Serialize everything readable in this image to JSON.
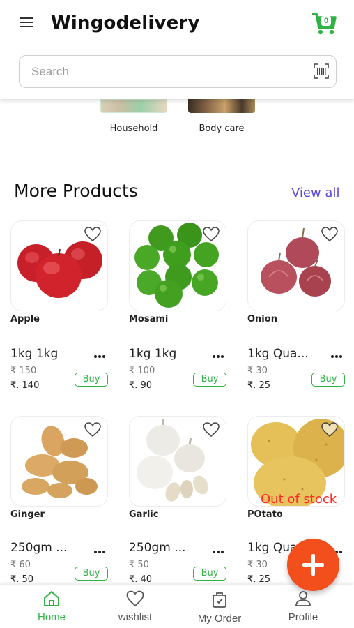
{
  "header": {
    "title": "Wingodelivery",
    "cart_count": "0",
    "search_placeholder": "Search"
  },
  "categories": [
    {
      "label": "Household"
    },
    {
      "label": "Body care"
    }
  ],
  "section": {
    "title": "More Products",
    "view_all": "View all"
  },
  "products": [
    {
      "name": "Apple",
      "qty": "1kg 1kg",
      "mrp": "₹ 150",
      "price": "₹. 140",
      "buy": "Buy"
    },
    {
      "name": "Mosami",
      "qty": "1kg 1kg",
      "mrp": "₹ 100",
      "price": "₹. 90",
      "buy": "Buy"
    },
    {
      "name": "Onion",
      "qty": "1kg Qua...",
      "mrp": "₹ 30",
      "price": "₹. 25",
      "buy": "Buy"
    },
    {
      "name": "Ginger",
      "qty": "250gm ...",
      "mrp": "₹ 60",
      "price": "₹. 50",
      "buy": "Buy"
    },
    {
      "name": "Garlic",
      "qty": "250gm ...",
      "mrp": "₹ 50",
      "price": "₹. 40",
      "buy": "Buy"
    },
    {
      "name": "POtato",
      "qty": "1kg Qua...",
      "mrp": "₹ 30",
      "price": "₹. 25",
      "stock_label": "Out of stock"
    }
  ],
  "bottom_nav": [
    {
      "label": "Home",
      "icon": "home-icon",
      "active": true
    },
    {
      "label": "wishlist",
      "icon": "heart-icon",
      "active": false
    },
    {
      "label": "My Order",
      "icon": "bag-icon",
      "active": false
    },
    {
      "label": "Profile",
      "icon": "user-icon",
      "active": false
    }
  ],
  "colors": {
    "brand_green": "#2fb344",
    "link_purple": "#5b4bd8",
    "fab_orange": "#f24f1c",
    "out_of_stock_red": "#ff2a2a"
  }
}
